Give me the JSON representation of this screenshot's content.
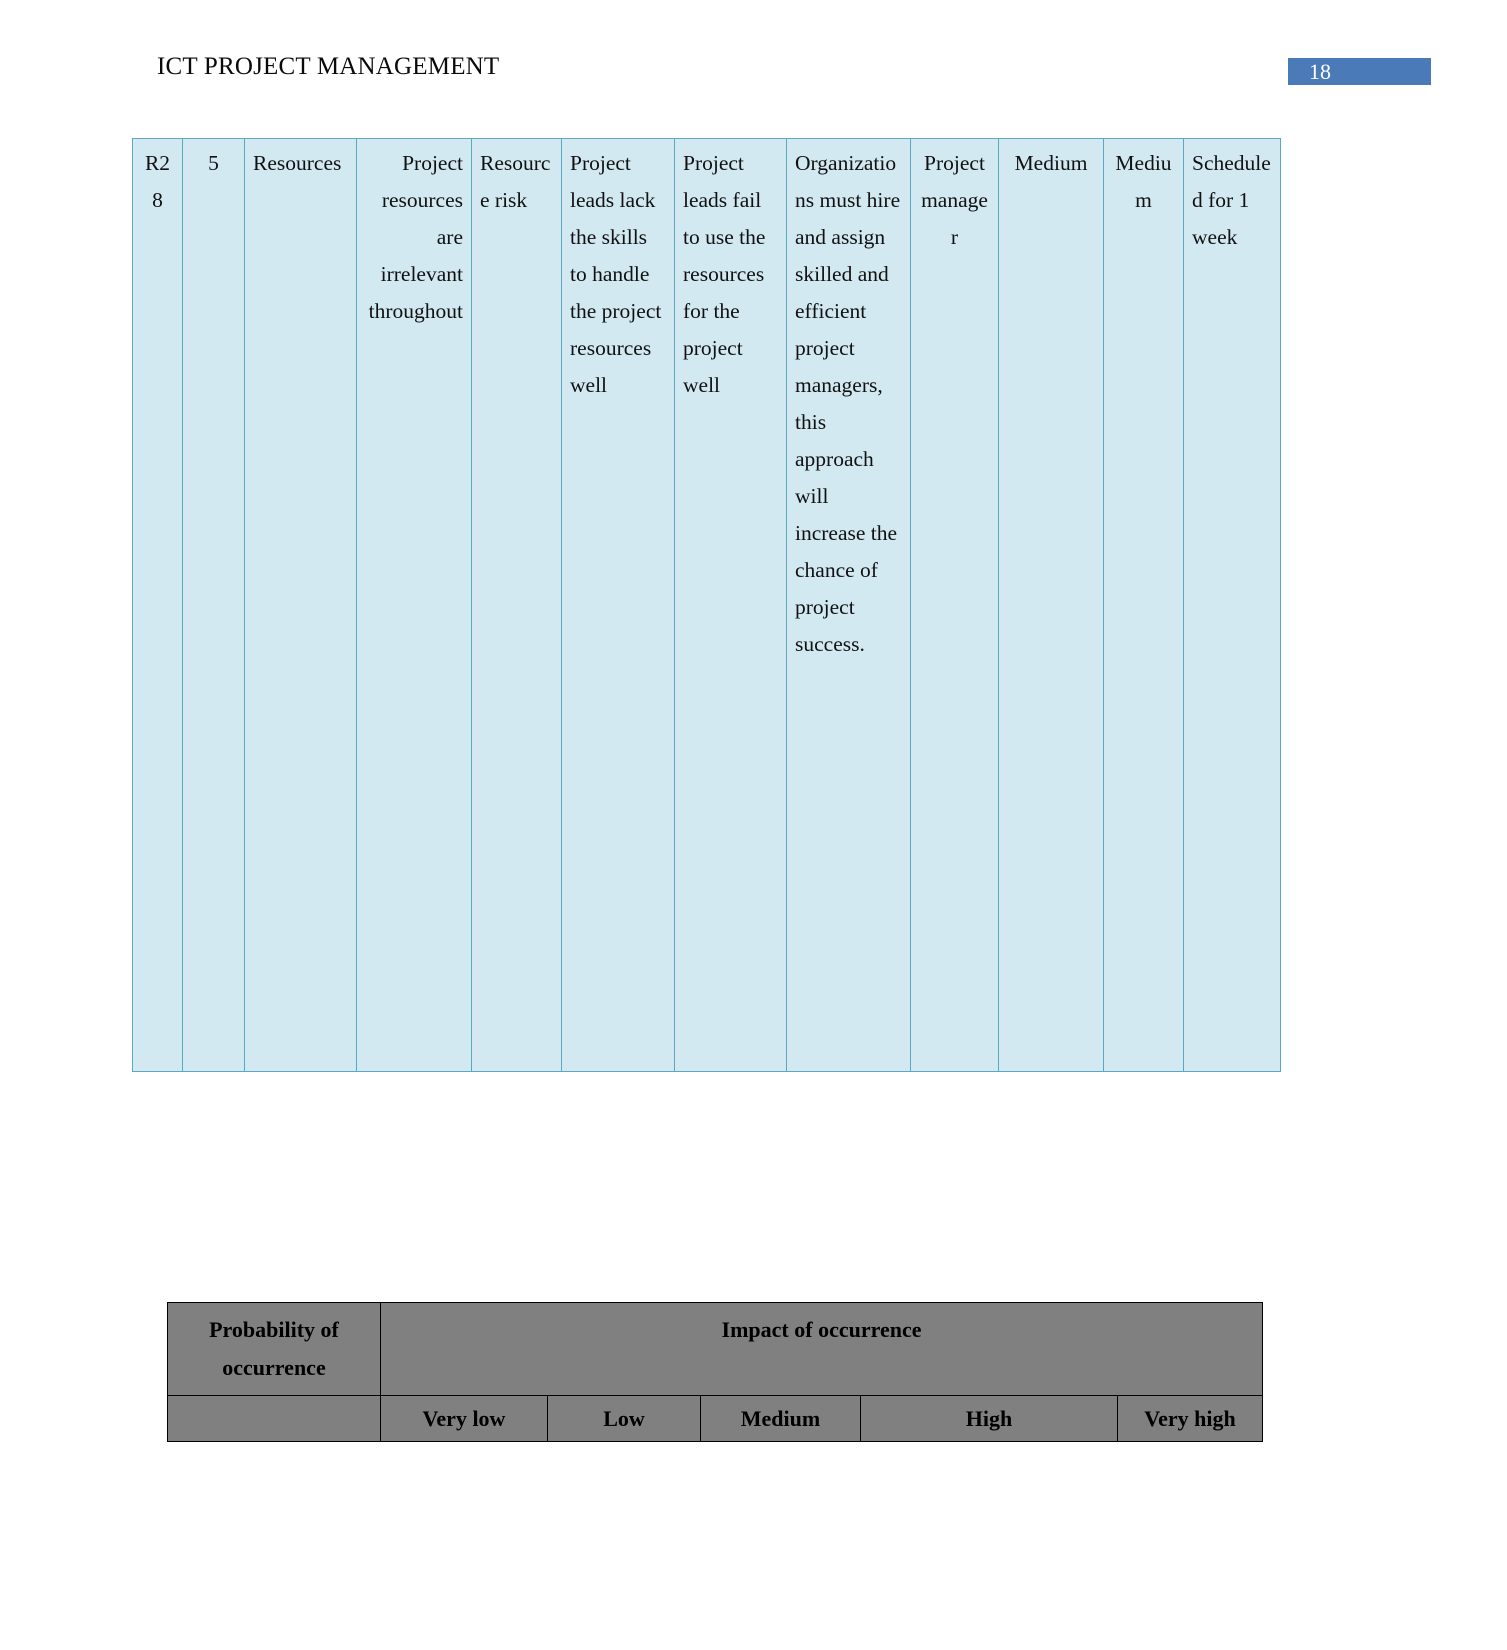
{
  "header": {
    "title": "ICT PROJECT MANAGEMENT",
    "page_number": "18",
    "badge_color": "#4a7ab8"
  },
  "risk_table": {
    "fill_color": "#d2e9f1",
    "border_color": "#5aa8c2",
    "columns": [
      {
        "key": "risk_id",
        "align": "center"
      },
      {
        "key": "rank",
        "align": "center"
      },
      {
        "key": "category",
        "align": "left"
      },
      {
        "key": "description",
        "align": "right"
      },
      {
        "key": "risk_type",
        "align": "left"
      },
      {
        "key": "root_cause",
        "align": "left"
      },
      {
        "key": "trigger",
        "align": "left"
      },
      {
        "key": "response",
        "align": "left"
      },
      {
        "key": "owner",
        "align": "center"
      },
      {
        "key": "probability",
        "align": "center"
      },
      {
        "key": "impact",
        "align": "center"
      },
      {
        "key": "status",
        "align": "left"
      }
    ],
    "rows": [
      {
        "risk_id": "R28",
        "rank": "5",
        "category": "Resources",
        "description": "Project resources are irrelevant throughout",
        "risk_type": "Resource risk",
        "root_cause": "Project leads lack the skills to handle the project resources well",
        "trigger": "Project leads fail to use the resources for the project well",
        "response": "Organizations must hire and assign skilled and efficient project managers, this approach will increase the chance of project success.",
        "owner": "Project manager",
        "probability": "Medium",
        "impact": "Medium",
        "status": "Scheduled for 1 week"
      }
    ]
  },
  "matrix_table": {
    "fill_color": "#808080",
    "border_color": "#000000",
    "header_probability": "Probability of occurrence",
    "header_impact": "Impact of occurrence",
    "probability_blank": "",
    "impact_levels": [
      "Very low",
      "Low",
      "Medium",
      "High",
      "Very high"
    ]
  }
}
